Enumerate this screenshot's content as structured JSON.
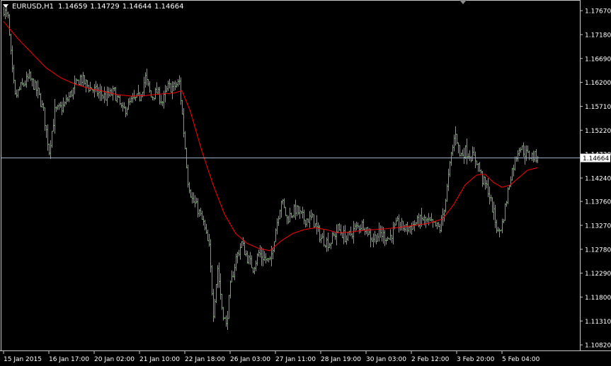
{
  "header": {
    "symbol": "EURUSD,H1",
    "open": "1.14659",
    "high": "1.14729",
    "low": "1.14644",
    "close": "1.14664"
  },
  "colors": {
    "background": "#000000",
    "candles": "#5cb84a",
    "moving_average": "#ff0000",
    "bid_line": "#9fb0c8",
    "price_label_bg": "#ffffff",
    "frame": "#ffffff"
  },
  "chart_data": {
    "type": "bar",
    "style": "ohlc-bars",
    "ylim": [
      1.1072,
      1.1786
    ],
    "current_price": 1.14664,
    "current_price_label": "1.14664",
    "y_ticks": [
      1.1767,
      1.1718,
      1.1669,
      1.162,
      1.1571,
      1.1522,
      1.1473,
      1.1424,
      1.1376,
      1.1327,
      1.1278,
      1.1229,
      1.118,
      1.1131,
      1.1082
    ],
    "y_tick_labels": [
      "1.17670",
      "1.17180",
      "1.16690",
      "1.16200",
      "1.15710",
      "1.15220",
      "1.14730",
      "1.14240",
      "1.13760",
      "1.13270",
      "1.12780",
      "1.12290",
      "1.11800",
      "1.11310",
      "1.10820"
    ],
    "x_tick_labels": [
      "15 Jan 2015",
      "16 Jan 17:00",
      "20 Jan 02:00",
      "21 Jan 10:00",
      "22 Jan 18:00",
      "26 Jan 03:00",
      "27 Jan 11:00",
      "28 Jan 19:00",
      "30 Jan 03:00",
      "2 Feb 12:00",
      "3 Feb 20:00",
      "5 Feb 04:00"
    ],
    "x_tick_bar_index": [
      0,
      32,
      64,
      96,
      128,
      160,
      192,
      224,
      256,
      288,
      320,
      352
    ],
    "bar_count": 378,
    "series": [
      {
        "kind": "close-path",
        "anchors": [
          [
            0,
            1.177
          ],
          [
            3,
            1.175
          ],
          [
            6,
            1.164
          ],
          [
            8,
            1.159
          ],
          [
            12,
            1.161
          ],
          [
            18,
            1.163
          ],
          [
            24,
            1.16
          ],
          [
            28,
            1.156
          ],
          [
            32,
            1.148
          ],
          [
            36,
            1.156
          ],
          [
            42,
            1.157
          ],
          [
            48,
            1.16
          ],
          [
            54,
            1.163
          ],
          [
            60,
            1.161
          ],
          [
            66,
            1.16
          ],
          [
            72,
            1.159
          ],
          [
            78,
            1.16
          ],
          [
            84,
            1.156
          ],
          [
            90,
            1.158
          ],
          [
            96,
            1.159
          ],
          [
            100,
            1.163
          ],
          [
            104,
            1.159
          ],
          [
            108,
            1.16
          ],
          [
            112,
            1.158
          ],
          [
            116,
            1.161
          ],
          [
            120,
            1.161
          ],
          [
            124,
            1.162
          ],
          [
            127,
            1.152
          ],
          [
            130,
            1.142
          ],
          [
            133,
            1.138
          ],
          [
            137,
            1.136
          ],
          [
            141,
            1.133
          ],
          [
            145,
            1.128
          ],
          [
            148,
            1.115
          ],
          [
            151,
            1.124
          ],
          [
            154,
            1.116
          ],
          [
            157,
            1.112
          ],
          [
            160,
            1.12
          ],
          [
            164,
            1.126
          ],
          [
            168,
            1.129
          ],
          [
            172,
            1.126
          ],
          [
            176,
            1.124
          ],
          [
            180,
            1.127
          ],
          [
            184,
            1.126
          ],
          [
            188,
            1.125
          ],
          [
            192,
            1.132
          ],
          [
            196,
            1.138
          ],
          [
            200,
            1.134
          ],
          [
            206,
            1.136
          ],
          [
            212,
            1.134
          ],
          [
            218,
            1.134
          ],
          [
            224,
            1.13
          ],
          [
            230,
            1.129
          ],
          [
            236,
            1.132
          ],
          [
            242,
            1.13
          ],
          [
            248,
            1.132
          ],
          [
            254,
            1.133
          ],
          [
            260,
            1.13
          ],
          [
            266,
            1.131
          ],
          [
            272,
            1.13
          ],
          [
            278,
            1.133
          ],
          [
            284,
            1.132
          ],
          [
            290,
            1.133
          ],
          [
            296,
            1.134
          ],
          [
            302,
            1.133
          ],
          [
            308,
            1.132
          ],
          [
            312,
            1.138
          ],
          [
            316,
            1.147
          ],
          [
            319,
            1.152
          ],
          [
            322,
            1.147
          ],
          [
            326,
            1.148
          ],
          [
            330,
            1.147
          ],
          [
            334,
            1.146
          ],
          [
            338,
            1.142
          ],
          [
            342,
            1.14
          ],
          [
            346,
            1.135
          ],
          [
            349,
            1.131
          ],
          [
            352,
            1.133
          ],
          [
            355,
            1.138
          ],
          [
            358,
            1.143
          ],
          [
            361,
            1.146
          ],
          [
            364,
            1.149
          ],
          [
            367,
            1.148
          ],
          [
            370,
            1.147
          ],
          [
            374,
            1.1468
          ],
          [
            377,
            1.14664
          ]
        ]
      },
      {
        "kind": "moving-average",
        "anchors": [
          [
            0,
            1.1745
          ],
          [
            10,
            1.171
          ],
          [
            20,
            1.168
          ],
          [
            30,
            1.165
          ],
          [
            40,
            1.163
          ],
          [
            50,
            1.1617
          ],
          [
            60,
            1.1608
          ],
          [
            70,
            1.1602
          ],
          [
            80,
            1.1595
          ],
          [
            90,
            1.1592
          ],
          [
            100,
            1.1593
          ],
          [
            110,
            1.1596
          ],
          [
            120,
            1.1598
          ],
          [
            126,
            1.1603
          ],
          [
            132,
            1.156
          ],
          [
            140,
            1.148
          ],
          [
            148,
            1.141
          ],
          [
            156,
            1.135
          ],
          [
            164,
            1.131
          ],
          [
            172,
            1.129
          ],
          [
            180,
            1.128
          ],
          [
            188,
            1.1275
          ],
          [
            196,
            1.1295
          ],
          [
            204,
            1.131
          ],
          [
            212,
            1.1318
          ],
          [
            220,
            1.1322
          ],
          [
            228,
            1.1318
          ],
          [
            236,
            1.1312
          ],
          [
            244,
            1.1313
          ],
          [
            252,
            1.1316
          ],
          [
            260,
            1.1318
          ],
          [
            270,
            1.132
          ],
          [
            280,
            1.1323
          ],
          [
            290,
            1.1327
          ],
          [
            300,
            1.1331
          ],
          [
            310,
            1.134
          ],
          [
            318,
            1.137
          ],
          [
            326,
            1.141
          ],
          [
            334,
            1.143
          ],
          [
            340,
            1.1432
          ],
          [
            346,
            1.1415
          ],
          [
            352,
            1.1405
          ],
          [
            358,
            1.141
          ],
          [
            364,
            1.1425
          ],
          [
            370,
            1.144
          ],
          [
            377,
            1.1445
          ]
        ]
      }
    ]
  }
}
